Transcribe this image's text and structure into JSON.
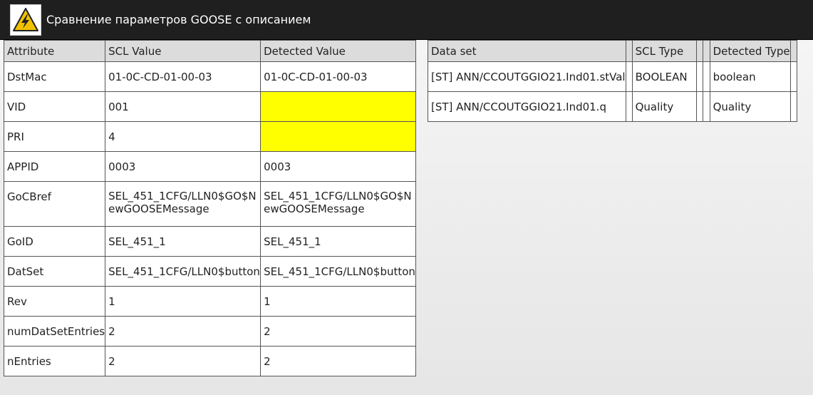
{
  "header": {
    "title": "Сравнение параметров GOOSE с описанием",
    "icon": "high-voltage-warning-icon",
    "bar_color": "#1f1f1f"
  },
  "params_table": {
    "columns": [
      "Attribute",
      "SCL Value",
      "Detected Value"
    ],
    "rows": [
      {
        "attribute": "DstMac",
        "scl": "01-0C-CD-01-00-03",
        "detected": "01-0C-CD-01-00-03",
        "mismatch": false
      },
      {
        "attribute": "VID",
        "scl": "001",
        "detected": "",
        "mismatch": true
      },
      {
        "attribute": "PRI",
        "scl": "4",
        "detected": "",
        "mismatch": true
      },
      {
        "attribute": "APPID",
        "scl": "0003",
        "detected": "0003",
        "mismatch": false
      },
      {
        "attribute": "GoCBref",
        "scl": "SEL_451_1CFG/LLN0$GO$NewGOOSEMessage",
        "detected": "SEL_451_1CFG/LLN0$GO$NewGOOSEMessage",
        "mismatch": false
      },
      {
        "attribute": "GoID",
        "scl": "SEL_451_1",
        "detected": "SEL_451_1",
        "mismatch": false
      },
      {
        "attribute": "DatSet",
        "scl": "SEL_451_1CFG/LLN0$button",
        "detected": "SEL_451_1CFG/LLN0$button",
        "mismatch": false
      },
      {
        "attribute": "Rev",
        "scl": "1",
        "detected": "1",
        "mismatch": false
      },
      {
        "attribute": "numDatSetEntries",
        "scl": "2",
        "detected": "2",
        "mismatch": false
      },
      {
        "attribute": "nEntries",
        "scl": "2",
        "detected": "2",
        "mismatch": false
      }
    ],
    "mismatch_color": "#ffff00"
  },
  "dataset_table": {
    "columns": [
      "Data set",
      "",
      "SCL Type",
      "",
      "",
      "Detected Type",
      ""
    ],
    "rows": [
      {
        "dataset": "[ST] ANN/CCOUTGGIO21.Ind01.stVal",
        "scl_type": "BOOLEAN",
        "detected_type": "boolean"
      },
      {
        "dataset": "[ST] ANN/CCOUTGGIO21.Ind01.q",
        "scl_type": "Quality",
        "detected_type": "Quality"
      }
    ]
  }
}
